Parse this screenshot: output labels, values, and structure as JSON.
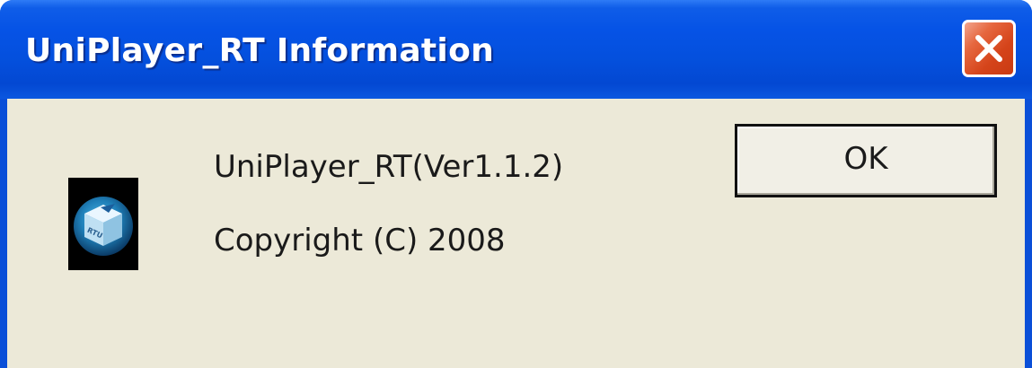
{
  "window": {
    "title": "UniPlayer_RT Information"
  },
  "dialog": {
    "app_icon": "uniplayer-cube-icon",
    "version_text": "UniPlayer_RT(Ver1.1.2)",
    "copyright_text": "Copyright (C) 2008",
    "ok_label": "OK"
  },
  "titlebar_controls": {
    "close_icon": "close-x-icon"
  },
  "colors": {
    "titlebar_blue": "#0653e6",
    "client_background": "#ece9d8",
    "close_button_red": "#d5441a"
  }
}
